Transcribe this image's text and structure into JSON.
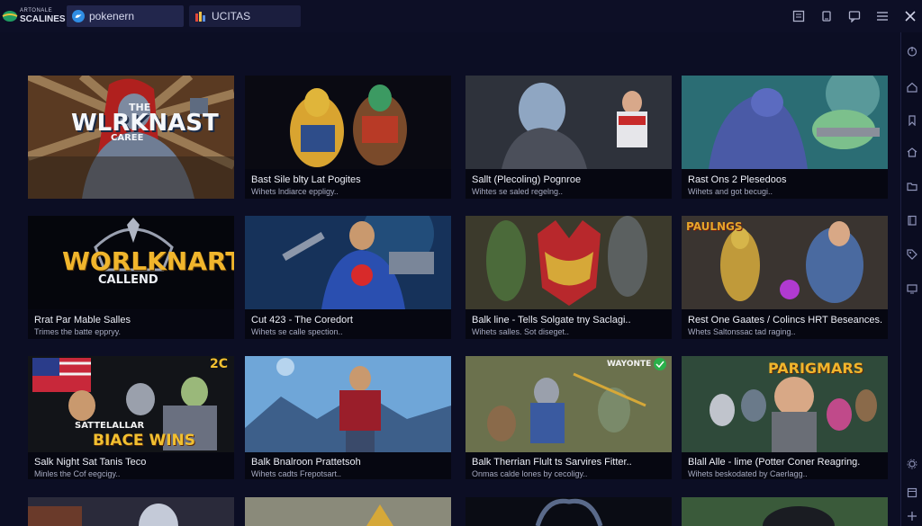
{
  "app": {
    "logo_line1": "ARTONALE",
    "logo_line2": "SCALINES"
  },
  "tabs": [
    {
      "label": "pokenern",
      "icon": "bird-icon"
    },
    {
      "label": "UCITAS",
      "icon": "app-icon"
    }
  ],
  "colors": {
    "background": "#0c0e24",
    "card": "#060711",
    "accent": "#2f8de4"
  },
  "cards": [
    {
      "title": "",
      "subtitle": "",
      "art_line1": "THE",
      "art_line2": "WLRKNAST",
      "art_line3": "CAREE"
    },
    {
      "title": "Bast Sile blty Lat Pogites",
      "subtitle": "Wihets lndiarce eppligy.."
    },
    {
      "title": "Sallt (Plecoling) Pognroe",
      "subtitle": "Wihtes se saled regelng.."
    },
    {
      "title": "Rast Ons 2 Plesedoos",
      "subtitle": "Wihets and got becugi.."
    },
    {
      "title": "Rrat Par Mable Salles",
      "subtitle": "Trimes the batte eppryy.",
      "art_line1": "WORLKNART",
      "art_line2": "CALLEND"
    },
    {
      "title": "Cut 423 - The Coredort",
      "subtitle": "Wihets se calle spection.."
    },
    {
      "title": "Balk line - Tells Solgate tny Saclagi..",
      "subtitle": "Wihets salles. Sot diseget.."
    },
    {
      "title": "Rest One Gaates / Colincs HRT Beseances.",
      "subtitle": "Whets Saltonssac tad raging..",
      "art_line1": "PAULNGS"
    },
    {
      "title": "Salk Night Sat Tanis Teco",
      "subtitle": "Minles the Cof eegcigy..",
      "art_line1": "2C",
      "art_line2": "SATTELALLAR",
      "art_line3": "BIACE WINS"
    },
    {
      "title": "Balk Bnalroon Prattetsoh",
      "subtitle": "Wihets cadts Frepotsart.."
    },
    {
      "title": "Balk Therrian Flult ts Sarvires Fitter..",
      "subtitle": "Onmas calde lones by cecoligy..",
      "art_line1": "WAYONTE"
    },
    {
      "title": "Blall Alle - lime (Potter Coner Reagring.",
      "subtitle": "Wihets beskodated by Caerlagg..",
      "art_line1": "PARIGMARS"
    }
  ]
}
